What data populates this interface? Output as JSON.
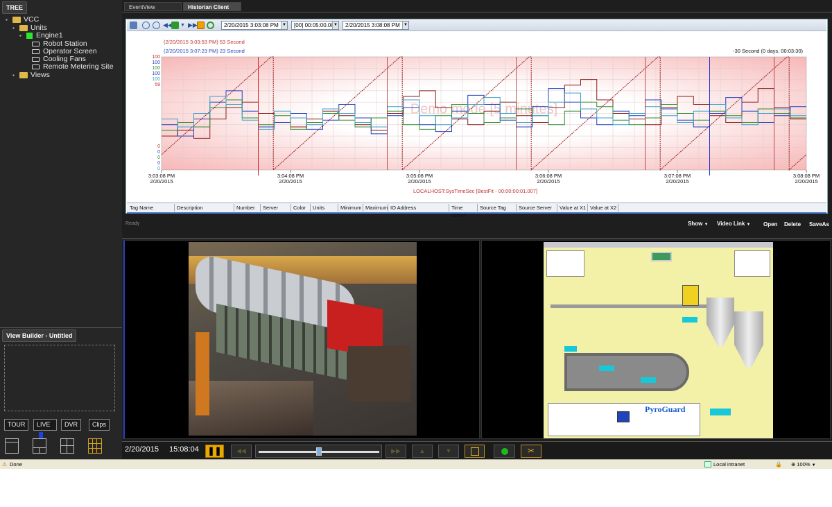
{
  "left": {
    "tree_tab": "TREE",
    "tree": [
      {
        "label": "VCC"
      },
      {
        "label": "Units"
      },
      {
        "label": "Engine1"
      },
      {
        "label": "Robot Station"
      },
      {
        "label": "Operator Screen"
      },
      {
        "label": "Cooling Fans"
      },
      {
        "label": "Remote Metering Site"
      },
      {
        "label": "Views"
      }
    ],
    "view_builder": "View Builder - Untitled",
    "buttons": {
      "tour": "TOUR",
      "live": "LIVE",
      "dvr": "DVR",
      "clips": "Clips"
    }
  },
  "tabs": [
    "EventView",
    "Historian Client"
  ],
  "toolbar": {
    "start": "2/20/2015   3:03:08 PM",
    "duration": "[00] 00:05:00.000",
    "end": "2/20/2015   3:08:08 PM"
  },
  "chart_data": {
    "type": "line",
    "cursor1_label": "(2/20/2015 3:03:53 PM) 53 Second",
    "cursor2_label": "(2/20/2015 3:07:23 PM) 23 Second",
    "range_label": "-30 Second (0 days, 00:03:30)",
    "footer": "LOCALHOST:SysTimeSec [BestFit - 00:00:00:01.007]",
    "watermark": "Demo mode [5 minutes]",
    "y_top": [
      "100",
      "100",
      "100",
      "100",
      "100",
      "59"
    ],
    "y_bottom": [
      "0",
      "0",
      "0",
      "0",
      "0"
    ],
    "x_ticks": [
      {
        "time": "3:03:08 PM",
        "date": "2/20/2015"
      },
      {
        "time": "3:04:08 PM",
        "date": "2/20/2015"
      },
      {
        "time": "3:05:08 PM",
        "date": "2/20/2015"
      },
      {
        "time": "3:06:08 PM",
        "date": "2/20/2015"
      },
      {
        "time": "3:07:08 PM",
        "date": "2/20/2015"
      },
      {
        "time": "3:08:08 PM",
        "date": "2/20/2015"
      }
    ],
    "xlim_seconds": [
      0,
      300
    ],
    "ylim": [
      0,
      100
    ],
    "series": [
      {
        "color": "#8b1a1a",
        "values": [
          30,
          35,
          28,
          45,
          55,
          60,
          50,
          42,
          38,
          45,
          52,
          48,
          40,
          35,
          50,
          65,
          70,
          55,
          45,
          40,
          52,
          60,
          48,
          42,
          55,
          75,
          80,
          62,
          50,
          45,
          40,
          55,
          65,
          58,
          48,
          42,
          60,
          72,
          55,
          45
        ]
      },
      {
        "color": "#1f3fbf",
        "values": [
          40,
          30,
          45,
          60,
          70,
          52,
          38,
          42,
          50,
          36,
          44,
          58,
          46,
          32,
          48,
          55,
          40,
          34,
          52,
          66,
          58,
          44,
          38,
          56,
          72,
          60,
          46,
          40,
          52,
          48,
          62,
          54,
          44,
          38,
          50,
          64,
          52,
          42,
          48,
          56
        ]
      },
      {
        "color": "#2e8b2e",
        "values": [
          35,
          42,
          38,
          55,
          62,
          46,
          40,
          48,
          36,
          42,
          50,
          44,
          38,
          46,
          52,
          40,
          36,
          48,
          58,
          50,
          42,
          46,
          54,
          48,
          40,
          52,
          60,
          56,
          44,
          40,
          46,
          58,
          50,
          44,
          52,
          48,
          42,
          54,
          50,
          46
        ]
      },
      {
        "color": "#3aa0c8",
        "values": [
          45,
          38,
          50,
          65,
          58,
          44,
          36,
          52,
          46,
          40,
          54,
          50,
          42,
          38,
          56,
          62,
          48,
          40,
          46,
          58,
          64,
          50,
          42,
          48,
          60,
          68,
          54,
          46,
          40,
          50,
          56,
          48,
          42,
          52,
          58,
          46,
          40,
          50,
          54,
          48
        ]
      }
    ],
    "sawtooth_color": "#9b1c1c",
    "cursor1_pct_of_range": 15,
    "cursor2_pct_of_range": 85
  },
  "columns": [
    "Tag Name",
    "Description",
    "Number",
    "Server",
    "Color",
    "Units",
    "Minimum",
    "Maximum",
    "IO Address",
    "Time Offset",
    "Source Tag",
    "Source Server",
    "Value at X1",
    "Value at X2"
  ],
  "ready": "Ready",
  "viewactions": {
    "show": "Show",
    "video_link": "Video Link",
    "open": "Open",
    "delete": "Delete",
    "saveas": "SaveAs"
  },
  "video": {
    "panel_text": "PyroGuard",
    "date": "2/20/2015",
    "time": "15:08:04"
  },
  "statusbar": {
    "done": "Done",
    "zone": "Local intranet",
    "zoom": "100%"
  }
}
